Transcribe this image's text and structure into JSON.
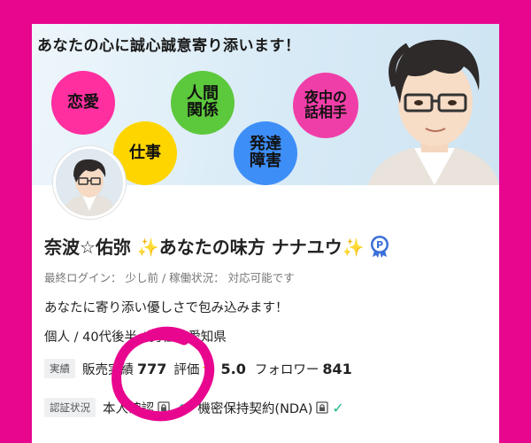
{
  "banner": {
    "title": "あなたの心に誠心誠意寄り添います！",
    "bubbles": [
      {
        "line1": "恋愛",
        "line2": ""
      },
      {
        "line1": "人間",
        "line2": "関係"
      },
      {
        "line1": "仕事",
        "line2": ""
      },
      {
        "line1": "夜中の",
        "line2": "話相手"
      },
      {
        "line1": "発達",
        "line2": "障害"
      }
    ]
  },
  "profile": {
    "name": "奈波☆佑弥 ✨あなたの味方 ナナユウ✨",
    "status": "最終ログイン： 少し前 / 稼働状況： 対応可能です",
    "catchphrase": "あなたに寄り添い優しさで包み込みます！",
    "attributes": "個人 / 40代後半 / 男性 / 愛知県"
  },
  "stats": {
    "tag": "実績",
    "sales_label": "販売実績",
    "sales_value": "777",
    "rating_label": "評価",
    "rating_value": "5.0",
    "followers_label": "フォロワー",
    "followers_value": "841"
  },
  "verification": {
    "tag": "認証状況",
    "item1": "本人確認",
    "nda_label": "機密保持契約(NDA)"
  },
  "colors": {
    "background": "#e8068f",
    "annotation": "#e8068f",
    "star": "#f5b800",
    "check": "#1fb58e"
  }
}
